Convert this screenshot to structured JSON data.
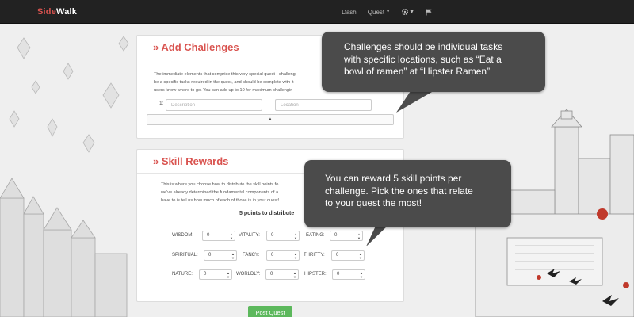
{
  "navbar": {
    "brand_part1": "Side",
    "brand_part2": "Walk",
    "links": [
      "Dash",
      "Quest"
    ],
    "icons": [
      "gear-icon",
      "flag-icon"
    ]
  },
  "challenges": {
    "title": "» Add Challenges",
    "description_lines": [
      "The immediate elements that comprise this very special quest - challeng",
      "be a specific tasks required in the quest, and should be complete with it",
      "users know where to go. You can add up to 10 for maximum challengin"
    ],
    "row_number": "1:",
    "description_placeholder": "Description",
    "location_placeholder": "Location",
    "add_icon": "caret-up-icon"
  },
  "skills": {
    "title": "» Skill Rewards",
    "description_lines": [
      "This is where you choose how to distribute the skill points fo",
      "we've already determined the fundamental components of a",
      "have to is tell us how much of each of those is in your quest!"
    ],
    "points_text": "5 points to distribute",
    "items": [
      {
        "label": "WISDOM:",
        "value": "0"
      },
      {
        "label": "VITALITY:",
        "value": "0"
      },
      {
        "label": "EATING:",
        "value": "0"
      },
      {
        "label": "SPIRITUAL:",
        "value": "0"
      },
      {
        "label": "FANCY:",
        "value": "0"
      },
      {
        "label": "THRIFTY:",
        "value": "0"
      },
      {
        "label": "NATURE:",
        "value": "0"
      },
      {
        "label": "WORLDLY:",
        "value": "0"
      },
      {
        "label": "HIPSTER:",
        "value": "0"
      }
    ]
  },
  "post_button": "Post Quest",
  "tooltips": [
    {
      "lines": [
        "Challenges should be individual tasks",
        "with specific locations, such as “Eat a",
        "bowl of ramen” at “Hipster Ramen”"
      ]
    },
    {
      "lines": [
        "You can reward 5 skill points per",
        "challenge. Pick the ones that relate",
        "to your quest the most!"
      ]
    }
  ],
  "colors": {
    "accent": "#d9534f",
    "navbar": "#222222",
    "success": "#5cb85c",
    "tooltip": "#4b4b4b"
  }
}
